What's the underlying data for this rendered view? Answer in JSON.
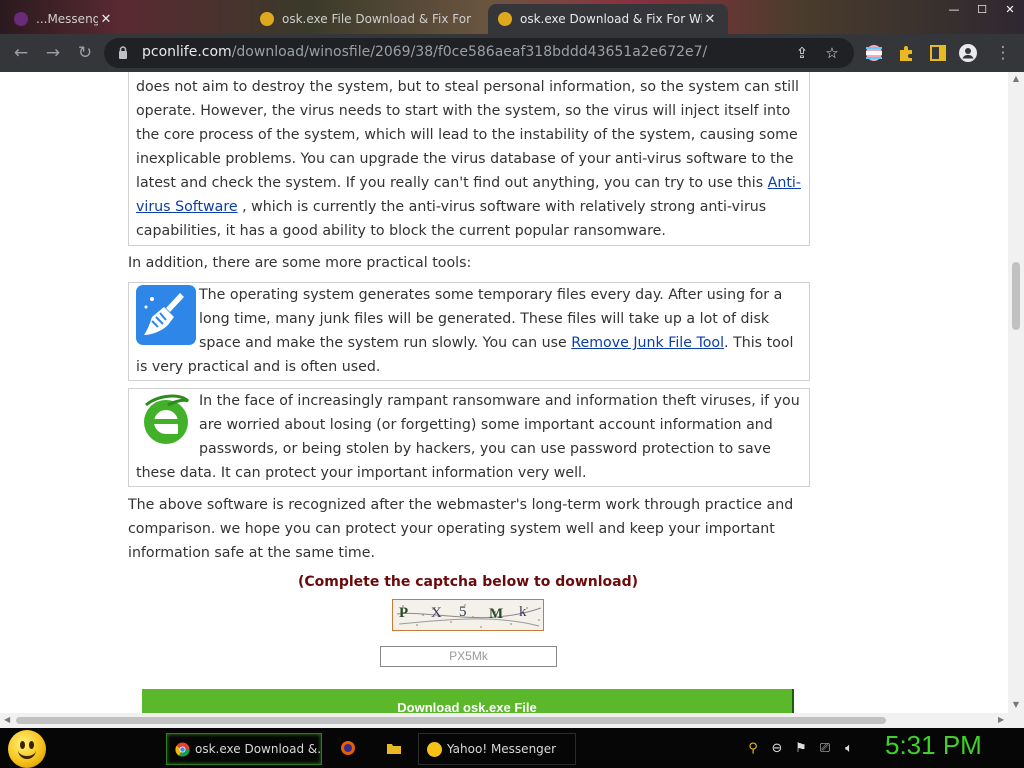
{
  "browser": {
    "tabs": [
      {
        "title": "...Messenger",
        "active": false
      },
      {
        "title": "osk.exe File Download & Fix For",
        "active": false
      },
      {
        "title": "osk.exe Download & Fix For Windows",
        "active": true
      }
    ],
    "url_domain": "pconlife.com",
    "url_path": "/download/winosfile/2069/38/f0ce586aeaf318bddd43651a2e672e7/"
  },
  "article": {
    "para1_text": "does not aim to destroy the system, but to steal personal information, so the system can still operate. However, the virus needs to start with the system, so the virus will inject itself into the core process of the system, which will lead to the instability of the system, causing some inexplicable problems. You can upgrade the virus database of your anti-virus software to the latest and check the system. If you really can't find out anything, you can try to use this ",
    "para1_link": "Anti-virus Software",
    "para1_after": " , which is currently the anti-virus software with relatively strong anti-virus capabilities, it has a good ability to block the current popular ransomware.",
    "tools_intro": "In addition, there are some more practical tools:",
    "tool1_text": "The operating system generates some temporary files every day. After using for a long time, many junk files will be generated. These files will take up a lot of disk space and make the system run slowly. You can use ",
    "tool1_link": "Remove Junk File Tool",
    "tool1_after": ". This tool is very practical and is often used.",
    "tool2_text": "In the face of increasingly rampant ransomware and information theft viruses, if you are worried about losing (or forgetting) some important account information and passwords, or being stolen by hackers, you can use password protection to save these data. It can protect your important information very well.",
    "closing": "The above software is recognized after the webmaster's long-term work through practice and comparison. we hope you can protect your operating system well and keep your important information safe at the same time."
  },
  "captcha": {
    "title": "(Complete the captcha below to download)",
    "chars": [
      "P",
      "X",
      "5",
      "M",
      "k"
    ],
    "input_placeholder": "PX5Mk",
    "download_label": "Download osk.exe File"
  },
  "taskbar": {
    "items": [
      {
        "label": "osk.exe Download &...",
        "active": true
      },
      {
        "label": "Yahoo! Messenger",
        "active": false
      }
    ],
    "clock": "5:31 PM"
  },
  "colors": {
    "link": "#0b3ea8",
    "captcha_title": "#6b0a0a",
    "download_button": "#5ab82a",
    "clock": "#3fd12a"
  }
}
